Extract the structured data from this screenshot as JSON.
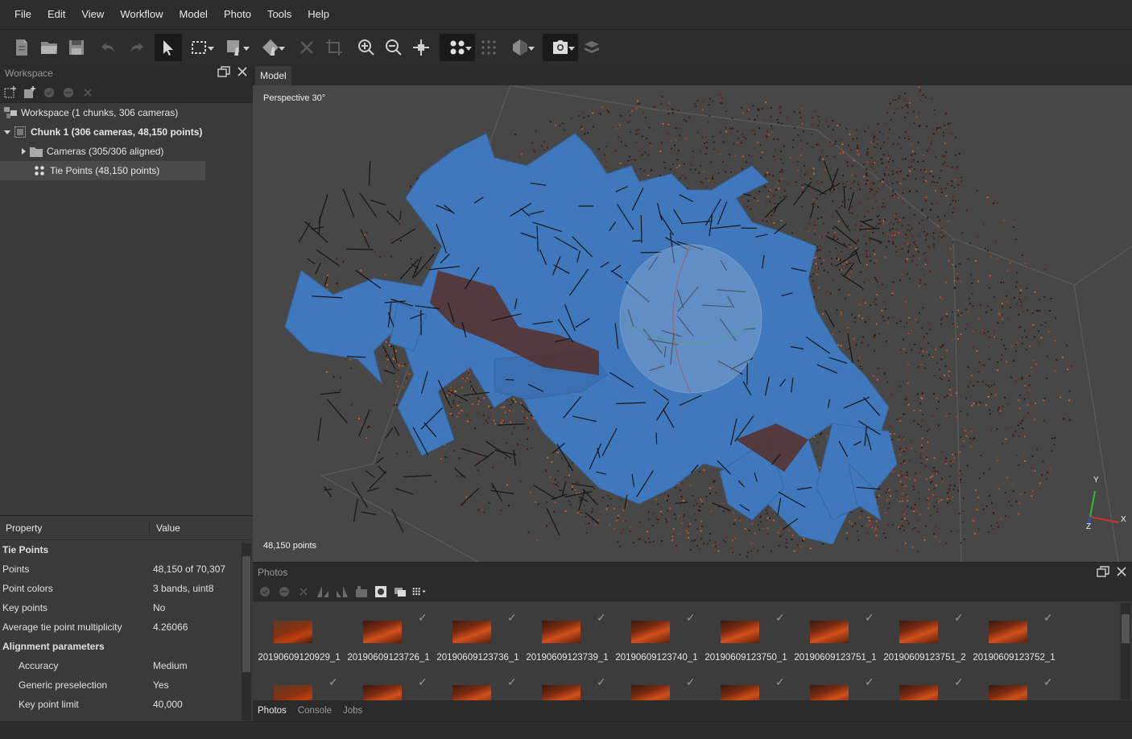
{
  "menu": [
    "File",
    "Edit",
    "View",
    "Workflow",
    "Model",
    "Photo",
    "Tools",
    "Help"
  ],
  "toolbar": {
    "icons": [
      "new-document-icon",
      "open-folder-icon",
      "save-icon",
      "undo-icon",
      "redo-icon",
      "navigation-pointer-icon",
      "rectangle-selection-icon",
      "resize-region-icon",
      "rotate-region-icon",
      "delete-selection-icon",
      "crop-selection-icon",
      "zoom-in-icon",
      "zoom-out-icon",
      "reset-view-icon",
      "point-cloud-icon",
      "dense-cloud-icon",
      "model-shaded-icon",
      "show-cameras-icon",
      "show-tiled-model-icon"
    ]
  },
  "workspace": {
    "title": "Workspace",
    "tree": {
      "root": "Workspace (1 chunks, 306 cameras)",
      "chunk": "Chunk 1 (306 cameras, 48,150 points)",
      "cameras": "Cameras (305/306 aligned)",
      "tie_points": "Tie Points (48,150 points)"
    }
  },
  "properties": {
    "col_property": "Property",
    "col_value": "Value",
    "rows": [
      {
        "k": "Tie Points",
        "v": "",
        "group": true
      },
      {
        "k": "Points",
        "v": "48,150 of 70,307"
      },
      {
        "k": "Point colors",
        "v": "3 bands, uint8"
      },
      {
        "k": "Key points",
        "v": "No"
      },
      {
        "k": "Average tie point multiplicity",
        "v": "4.26066"
      },
      {
        "k": "Alignment parameters",
        "v": "",
        "group": true
      },
      {
        "k": "Accuracy",
        "v": "Medium",
        "indent": true
      },
      {
        "k": "Generic preselection",
        "v": "Yes",
        "indent": true
      },
      {
        "k": "Key point limit",
        "v": "40,000",
        "indent": true
      }
    ]
  },
  "model": {
    "tab": "Model",
    "projection": "Perspective 30°",
    "points_label": "48,150 points",
    "axis_x": "X",
    "axis_y": "Y",
    "axis_z": "Z"
  },
  "photos": {
    "title": "Photos",
    "items": [
      {
        "name": "20190609120929_1",
        "checked": false
      },
      {
        "name": "20190609123726_1",
        "checked": true
      },
      {
        "name": "20190609123736_1",
        "checked": true
      },
      {
        "name": "20190609123739_1",
        "checked": true
      },
      {
        "name": "20190609123740_1",
        "checked": true
      },
      {
        "name": "20190609123750_1",
        "checked": true
      },
      {
        "name": "20190609123751_1",
        "checked": true
      },
      {
        "name": "20190609123751_2",
        "checked": true
      },
      {
        "name": "20190609123752_1",
        "checked": true
      }
    ]
  },
  "bottom_tabs": [
    "Photos",
    "Console",
    "Jobs"
  ],
  "colors": {
    "camera_blue": "#3f78bd",
    "point_orange": "#d8501c",
    "viewport_bg": "#474747"
  }
}
